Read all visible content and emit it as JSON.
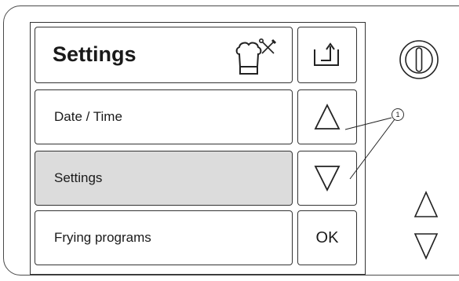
{
  "header": {
    "title": "Settings",
    "icon": "chef-hat-tools-icon",
    "back_icon": "exit-arrow-icon"
  },
  "menu": {
    "items": [
      {
        "label": "Date / Time",
        "selected": false
      },
      {
        "label": "Settings",
        "selected": true
      },
      {
        "label": "Frying programs",
        "selected": false
      }
    ]
  },
  "side_buttons": {
    "up_icon": "triangle-up-icon",
    "down_icon": "triangle-down-icon",
    "ok_label": "OK"
  },
  "hardware": {
    "power_icon": "power-icon",
    "up_icon": "triangle-up-icon",
    "down_icon": "triangle-down-icon"
  },
  "callout": {
    "number": "1"
  }
}
